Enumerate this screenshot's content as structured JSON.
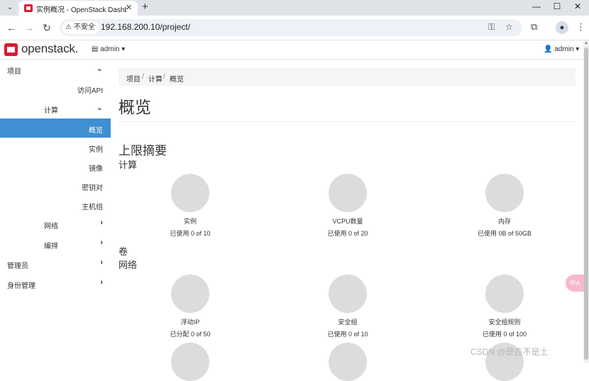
{
  "browser": {
    "tab_title": "实例概况 - OpenStack Dashbo",
    "new_tab": "+",
    "insecure_label": "不安全",
    "url": "192.168.200.10/project/",
    "tab_list_glyph": "⌄",
    "minimize": "—",
    "maximize": "☐",
    "close": "✕"
  },
  "navbar": {
    "brand": "openstack.",
    "project": "admin",
    "user": "admin"
  },
  "sidebar": {
    "items": [
      {
        "label": "项目"
      },
      {
        "label": "访问API"
      },
      {
        "label": "计算"
      },
      {
        "label": "概览"
      },
      {
        "label": "实例"
      },
      {
        "label": "镜像"
      },
      {
        "label": "密钥对"
      },
      {
        "label": "主机组"
      },
      {
        "label": "网络"
      },
      {
        "label": "编排"
      },
      {
        "label": "管理员"
      },
      {
        "label": "身份管理"
      }
    ]
  },
  "breadcrumb": {
    "items": [
      "项目",
      "计算",
      "概览"
    ],
    "sep": "/"
  },
  "page_title": "概览",
  "limit_summary": "上限摘要",
  "sections": {
    "compute": "计算",
    "volume": "卷",
    "network": "网络"
  },
  "compute_charts": [
    {
      "name": "实例",
      "usage": "已使用 0 of 10",
      "used": 0,
      "limit": 10
    },
    {
      "name": "VCPU数量",
      "usage": "已使用 0 of 20",
      "used": 0,
      "limit": 20
    },
    {
      "name": "内存",
      "usage": "已使用 0B of 50GB",
      "used": 0,
      "limit": 50
    }
  ],
  "network_charts": [
    {
      "name": "浮动IP",
      "usage": "已分配 0 of 50",
      "used": 0,
      "limit": 50
    },
    {
      "name": "安全组",
      "usage": "已使用 0 of 10",
      "used": 0,
      "limit": 10
    },
    {
      "name": "安全组规则",
      "usage": "已使用 0 of 100",
      "used": 0,
      "limit": 100
    }
  ],
  "translate_label": "中A",
  "watermark": "CSDN @是垚不是土",
  "colors": {
    "active_nav": "#3f8fd2",
    "brand_red": "#da1a32",
    "pie_empty": "#dcdcdc"
  }
}
